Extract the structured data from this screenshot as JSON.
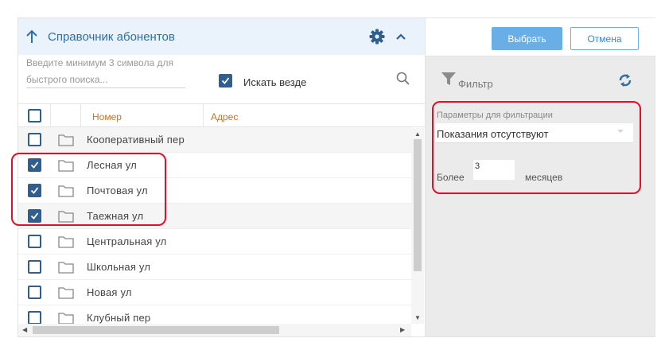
{
  "header": {
    "title": "Справочник абонентов",
    "up_icon": "arrow-up-icon",
    "gear_icon": "gear-icon",
    "chevron_icon": "chevron-up-icon"
  },
  "search": {
    "placeholder": "Введите минимум 3 символа для быстрого поиска...",
    "search_everywhere_label": "Искать везде",
    "search_everywhere_checked": true,
    "search_icon": "search-icon"
  },
  "table": {
    "columns": [
      "Номер",
      "Адрес"
    ],
    "rows": [
      {
        "name": "Кооперативный пер",
        "checked": false
      },
      {
        "name": "Лесная ул",
        "checked": true
      },
      {
        "name": "Почтовая ул",
        "checked": true
      },
      {
        "name": "Таежная ул",
        "checked": true
      },
      {
        "name": "Центральная ул",
        "checked": false
      },
      {
        "name": "Школьная ул",
        "checked": false
      },
      {
        "name": "Новая ул",
        "checked": false
      },
      {
        "name": "Клубный пер",
        "checked": false
      }
    ]
  },
  "actions": {
    "select_label": "Выбрать",
    "cancel_label": "Отмена"
  },
  "filter": {
    "title": "Фильтр",
    "params_label": "Параметры для фильтрации",
    "dropdown_value": "Показания отсутствуют",
    "more_label": "Более",
    "months_value": "3",
    "months_label": "месяцев"
  },
  "colors": {
    "accent": "#2f6ea6",
    "checkbox": "#2f5e8f",
    "column_header": "#c0762a",
    "highlight": "#e0102a",
    "primary_button": "#6aaee8"
  }
}
